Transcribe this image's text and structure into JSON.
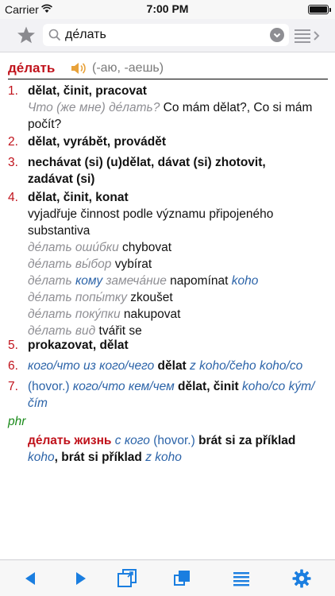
{
  "status": {
    "carrier": "Carrier",
    "time": "7:00 PM"
  },
  "search": {
    "value": "де́лать"
  },
  "entry": {
    "headword": "де́лать",
    "forms": "(-аю, -аешь)",
    "senses": [
      {
        "num": "1.",
        "main": "dělat, činit, pracovat",
        "ex_ru": "Что (же мне) де́лать?",
        "ex_cs_line1": "Co mám dělat?, Co si mám",
        "ex_cs_line2": "počít?"
      },
      {
        "num": "2.",
        "main": "dělat, vyrábět, provádět"
      },
      {
        "num": "3.",
        "main_line1": "nechávat (si) (u)dělat, dávat (si) zhotovit,",
        "main_line2": "zadávat (si)"
      },
      {
        "num": "4.",
        "main": "dělat, činit, konat",
        "desc_line1": "vyjadřuje činnost podle významu připojeného",
        "desc_line2": "substantiva",
        "examples": [
          {
            "ru": "де́лать оши́бки",
            "cs": "chybovat"
          },
          {
            "ru": "де́лать вы́бор",
            "cs": "vybírat"
          },
          {
            "ru_a": "де́лать",
            "ru_kw": "кому",
            "ru_b": "замеча́ние",
            "cs": "napomínat",
            "cs_kw": "koho"
          },
          {
            "ru": "де́лать попы́тку",
            "cs": "zkoušet"
          },
          {
            "ru": "де́лать поку́пки",
            "cs": "nakupovat"
          },
          {
            "ru": "де́лать вид",
            "cs": "tvářit se"
          }
        ]
      },
      {
        "num": "5.",
        "main": "prokazovat, dělat"
      },
      {
        "num": "6.",
        "kw": "кого/что из кого/чего",
        "main": "dělat",
        "kw_cs": "z koho/čeho koho/co"
      },
      {
        "num": "7.",
        "note": "(hovor.)",
        "kw": "кого/что кем/чем",
        "main": "dělat, činit",
        "kw_cs_line1": "koho/co kým/",
        "kw_cs_line2": "čím"
      }
    ],
    "phr_label": "phr",
    "phrase": {
      "ru": "де́лать жизнь",
      "kw": "с кого",
      "note": "(hovor.)",
      "main": "brát si za příklad",
      "kw_cs": "koho",
      "sep": ",",
      "main2": "brát si příklad",
      "kw_cs2": "z koho"
    }
  },
  "icons": {
    "star": "star-icon",
    "search": "search-icon",
    "clear": "clear-icon",
    "history": "history-list-icon",
    "prev": "prev-arrow-icon",
    "next": "next-arrow-icon",
    "window": "window-icon",
    "copy": "copy-icon",
    "list": "list-icon",
    "settings": "gear-icon"
  },
  "colors": {
    "accent": "#1a7ee0",
    "headword": "#c0121b",
    "keyword": "#2b63a8",
    "example": "#8e8e93",
    "phr": "#1a8a1a"
  }
}
